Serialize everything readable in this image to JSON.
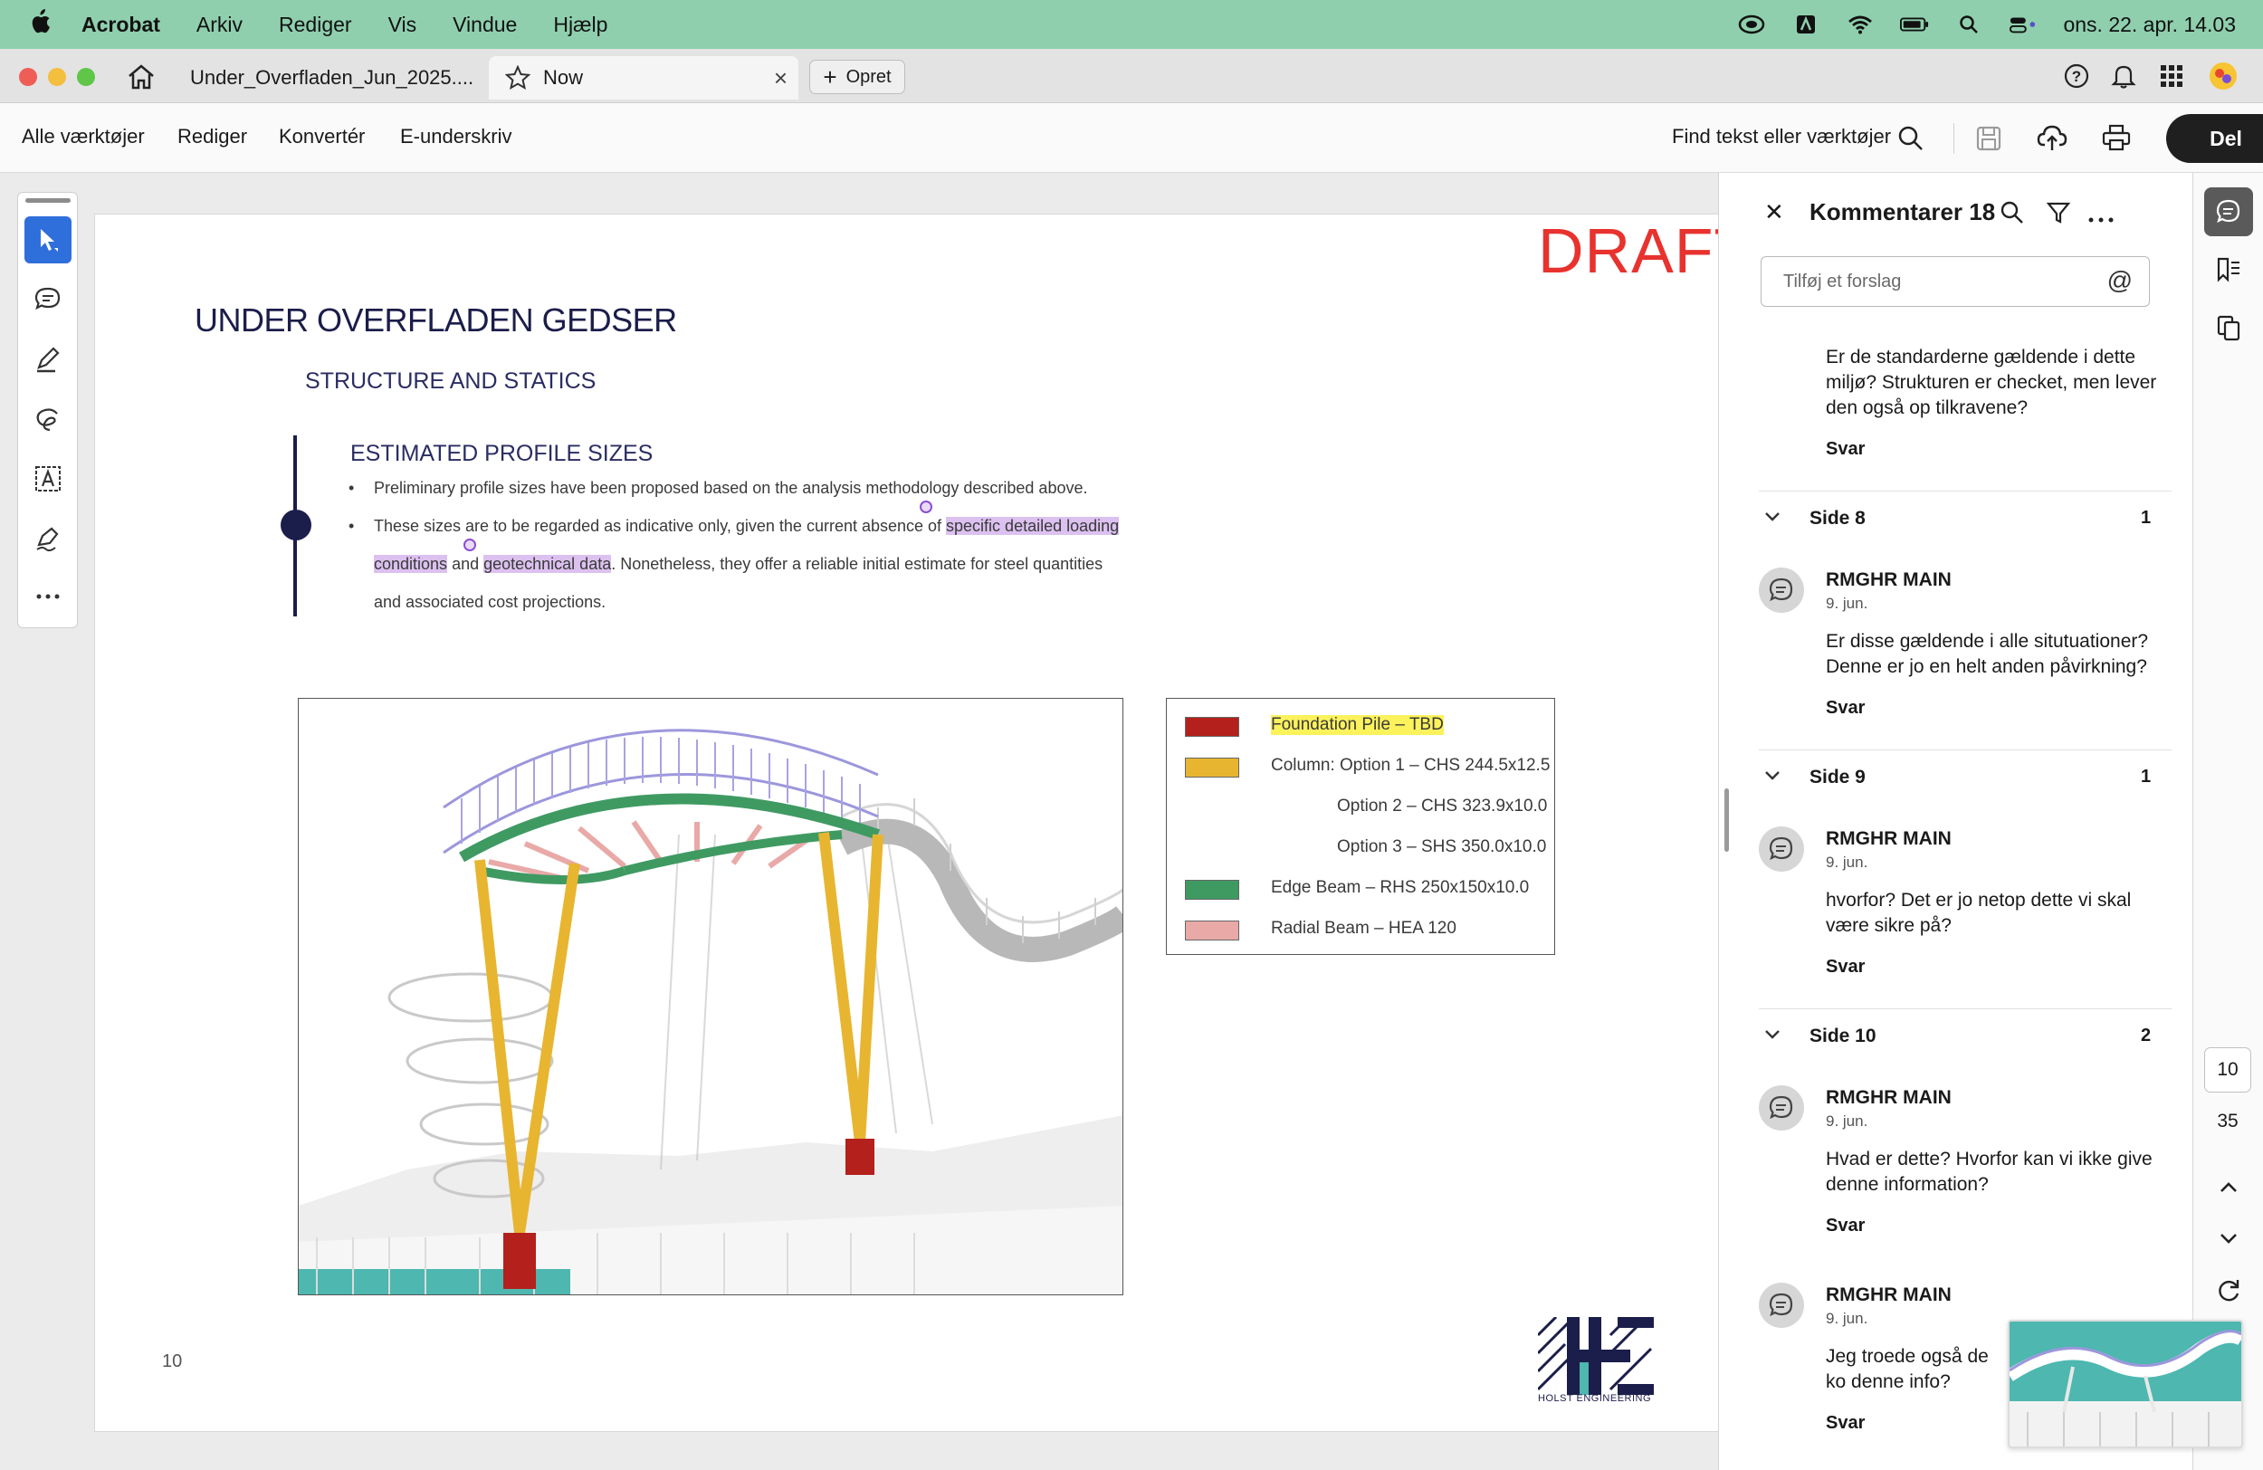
{
  "menubar": {
    "app_name": "Acrobat",
    "items": [
      "Arkiv",
      "Rediger",
      "Vis",
      "Vindue",
      "Hjælp"
    ],
    "datetime": "ons. 22. apr. 14.03"
  },
  "tabs": {
    "tab1_label": "Under_Overfladen_Jun_2025....",
    "tab2_label": "Now",
    "create_label": "Opret"
  },
  "toolbar": {
    "items": [
      "Alle værktøjer",
      "Rediger",
      "Konvertér",
      "E-underskriv"
    ],
    "search_label": "Find tekst eller værktøjer",
    "share_label": "Del"
  },
  "document": {
    "draft": "DRAFT",
    "title": "UNDER OVERFLADEN GEDSER",
    "subtitle": "STRUCTURE AND STATICS",
    "section_title": "ESTIMATED PROFILE SIZES",
    "bullet1": "Preliminary profile sizes have been proposed based on the analysis methodology described above.",
    "bullet2_a": "These sizes are to be regarded as indicative only, given the current absence of ",
    "bullet2_hl1": "specific detailed loading",
    "bullet2_hl2": "conditions",
    "bullet2_b": " and ",
    "bullet2_hl3": "geotechnical data",
    "bullet2_c": ". Nonetheless, they offer a reliable initial estimate for steel quantities",
    "bullet2_d": "and associated cost projections.",
    "legend": [
      {
        "label": "Foundation Pile – TBD",
        "color": "#b4201c"
      },
      {
        "label": "Column: Option 1 – CHS 244.5x12.5",
        "color": "#e8b530"
      },
      {
        "label": "Option 2 – CHS 323.9x10.0",
        "color": ""
      },
      {
        "label": "Option 3 – SHS 350.0x10.0",
        "color": ""
      },
      {
        "label": "Edge Beam – RHS 250x150x10.0",
        "color": "#3f9a62"
      },
      {
        "label": "Radial Beam – HEA 120",
        "color": "#e8a9a7"
      }
    ],
    "page_number": "10",
    "logo_text": "HOLST ENGINEERING"
  },
  "comments": {
    "title": "Kommentarer 18",
    "input_placeholder": "Tilføj et forslag",
    "reply_label": "Svar",
    "prev_comment": "Er de standarderne gældende i dette miljø? Strukturen er checket, men lever den også op tilkravene?",
    "groups": [
      {
        "side": "Side 8",
        "count": "1",
        "author": "RMGHR MAIN",
        "date": "9. jun.",
        "text": "Er disse gældende i alle situtuationer? Denne er jo en helt anden påvirkning?"
      },
      {
        "side": "Side 9",
        "count": "1",
        "author": "RMGHR MAIN",
        "date": "9. jun.",
        "text": "hvorfor? Det er jo netop dette vi skal være sikre på?"
      },
      {
        "side": "Side 10",
        "count": "2",
        "author": "RMGHR MAIN",
        "date": "9. jun.",
        "text": "Hvad er dette? Hvorfor kan vi ikke give denne information?"
      }
    ],
    "last": {
      "author": "RMGHR MAIN",
      "date": "9. jun.",
      "text": "Jeg troede også de ko denne info?"
    }
  },
  "rail": {
    "current_page": "10",
    "total_pages": "35"
  }
}
